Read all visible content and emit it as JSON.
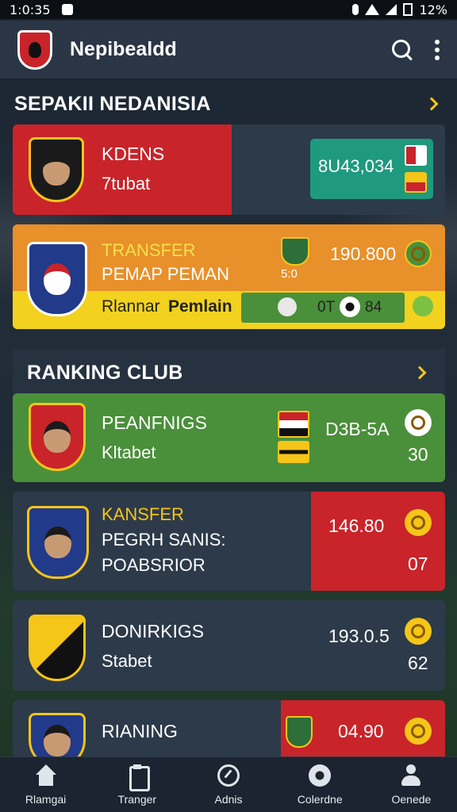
{
  "status_bar": {
    "time": "1:0:35",
    "battery": "12%"
  },
  "app": {
    "title": "Nepibealdd"
  },
  "sections": [
    {
      "title": "SEPAKII NEDANISIA"
    },
    {
      "title": "RANKING CLUB"
    }
  ],
  "cards": [
    {
      "name": "KDENS",
      "sub": "7tubat",
      "value": "8U43,034"
    },
    {
      "label_top": "TRANSFER",
      "label_mid": "PEMAP PEMAN",
      "value": "190.800",
      "flag_code": "5:0",
      "strip_label_a": "Rlannar",
      "strip_label_b": "Pemlain",
      "score_a": "0T",
      "score_b": "84"
    },
    {
      "name": "PEANFNIGS",
      "sub": "Kltabet",
      "value": "D3B-5A",
      "value2": "30"
    },
    {
      "label_top": "KANSFER",
      "label_mid": "PEGRH SANIS:",
      "label_bot": "POABSRIOR",
      "value": "146.80",
      "value2": "07"
    },
    {
      "name": "DONIRKIGS",
      "sub": "Stabet",
      "value": "193.0.5",
      "value2": "62"
    },
    {
      "name": "RIANING",
      "value": "04.90"
    }
  ],
  "nav": [
    {
      "label": "Rlamgai",
      "icon": "home-icon"
    },
    {
      "label": "Tranger",
      "icon": "clipboard-icon"
    },
    {
      "label": "Adnis",
      "icon": "gauge-icon"
    },
    {
      "label": "Colerdne",
      "icon": "ball-icon"
    },
    {
      "label": "Oenede",
      "icon": "user-icon"
    }
  ],
  "colors": {
    "red": "#c8242a",
    "green": "#4a8f3a",
    "orange": "#e8902a",
    "yellow": "#f5c518",
    "teal": "#1f9a7e",
    "card_dark": "#2c3a4a"
  }
}
